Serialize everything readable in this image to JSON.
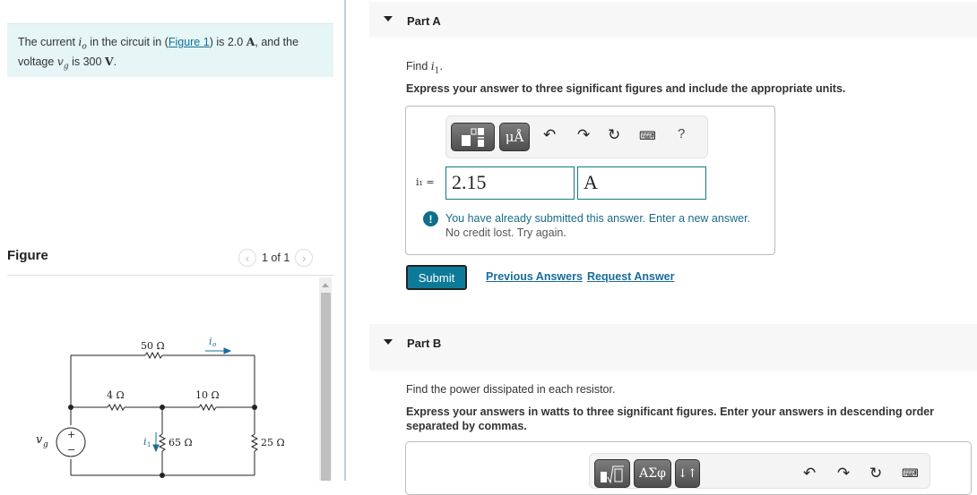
{
  "problem": {
    "intro_prefix": "The current ",
    "intro_var_io": "i",
    "intro_var_io_sub": "o",
    "intro_mid1": " in the circuit in (",
    "figure_link": "Figure 1",
    "intro_mid2": ") is 2.0 ",
    "intro_unit_a": "A",
    "intro_mid3": ", and the voltage ",
    "intro_var_vg": "v",
    "intro_var_vg_sub": "g",
    "intro_mid4": " is 300 ",
    "intro_unit_v": "V",
    "intro_end": "."
  },
  "figure": {
    "title": "Figure",
    "pager": "1 of 1",
    "prev_icon": "chevron-left-icon",
    "next_icon": "chevron-right-icon",
    "circuit": {
      "r_top": "50 Ω",
      "r_left": "4 Ω",
      "r_mid": "10 Ω",
      "r_center": "65 Ω",
      "r_right": "25 Ω",
      "current_io": "i",
      "current_io_sub": "o",
      "current_i1": "i",
      "current_i1_sub": "1",
      "source": "v",
      "source_sub": "g",
      "plus": "+",
      "minus": "−"
    }
  },
  "partA": {
    "label": "Part A",
    "find_prefix": "Find ",
    "find_var": "i",
    "find_var_sub": "1",
    "find_end": ".",
    "instruction": "Express your answer to three significant figures and include the appropriate units.",
    "toolbar": {
      "templates_icon": "templates-icon",
      "units_label": "μÅ",
      "undo_icon": "undo-icon",
      "redo_icon": "redo-icon",
      "reset_icon": "reset-icon",
      "keyboard_icon": "keyboard-icon",
      "help_label": "?"
    },
    "answer_label": "i₁ =",
    "value": "2.15",
    "unit": "A",
    "feedback_line1": "You have already submitted this answer. Enter a new answer.",
    "feedback_line2": "No credit lost. Try again.",
    "submit_label": "Submit",
    "previous_answers_label": "Previous Answers",
    "request_answer_label": "Request Answer"
  },
  "partB": {
    "label": "Part B",
    "prompt": "Find the power dissipated in each resistor.",
    "instruction_line1": "Express your answers in watts to three significant figures. Enter your answers in descending order",
    "instruction_line2": "separated by commas.",
    "toolbar": {
      "templates_icon": "sqrt-template-icon",
      "greek_label": "ΑΣφ",
      "sort_label": "↓↑",
      "undo_icon": "undo-icon",
      "redo_icon": "redo-icon",
      "reset_icon": "reset-icon",
      "keyboard_icon": "keyboard-icon"
    }
  }
}
